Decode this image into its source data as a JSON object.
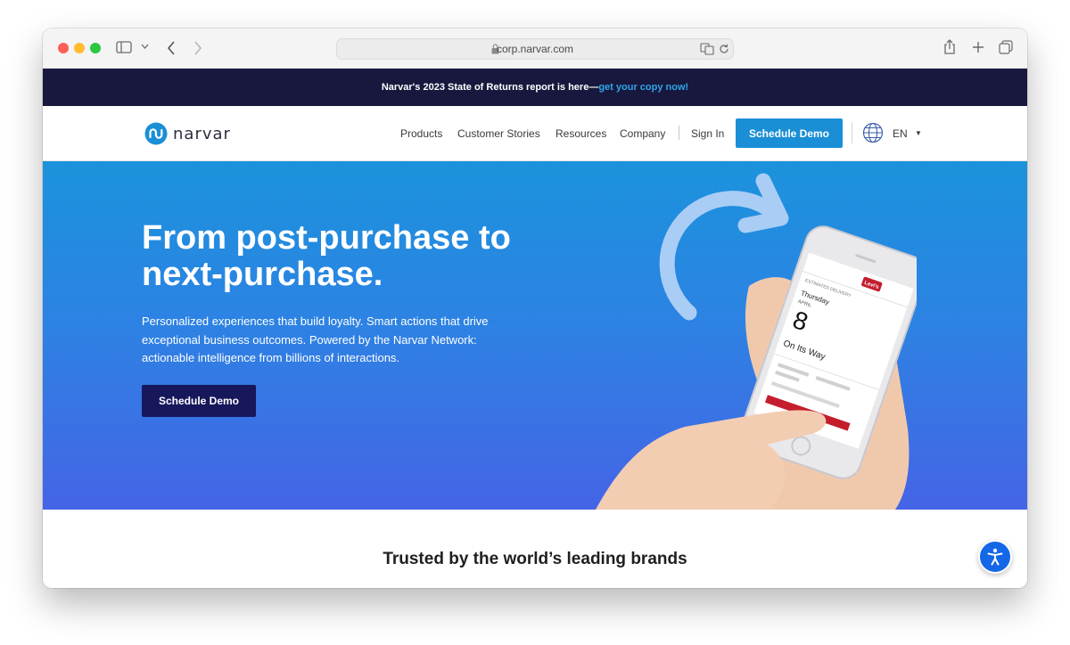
{
  "browser": {
    "url": "corp.narvar.com"
  },
  "announcement": {
    "text": "Narvar's 2023 State of Returns report is here—",
    "link": "get your copy now!"
  },
  "nav": {
    "logo_text": "narvar",
    "items": [
      "Products",
      "Customer Stories",
      "Resources",
      "Company"
    ],
    "sign_in": "Sign In",
    "demo_label": "Schedule Demo",
    "language": "EN"
  },
  "hero": {
    "title": "From post-purchase to next-purchase.",
    "subtitle": "Personalized experiences that build loyalty. Smart actions that drive exceptional business outcomes. Powered by the Narvar Network: actionable intelligence from billions of interactions.",
    "cta_label": "Schedule Demo",
    "phone": {
      "brand": "Levi's",
      "estimated": "ESTIMATED DELIVERY",
      "day": "Thursday",
      "month": "APRIL",
      "date": "8",
      "status": "On Its Way"
    }
  },
  "trusted": {
    "heading": "Trusted by the world’s leading brands"
  },
  "colors": {
    "announcement_bg": "#18183e",
    "accent_blue": "#1a8fd6",
    "hero_top": "#1b93dc",
    "hero_bottom": "#4564e6",
    "hero_button": "#17175c",
    "a11y_button": "#1467e6"
  }
}
